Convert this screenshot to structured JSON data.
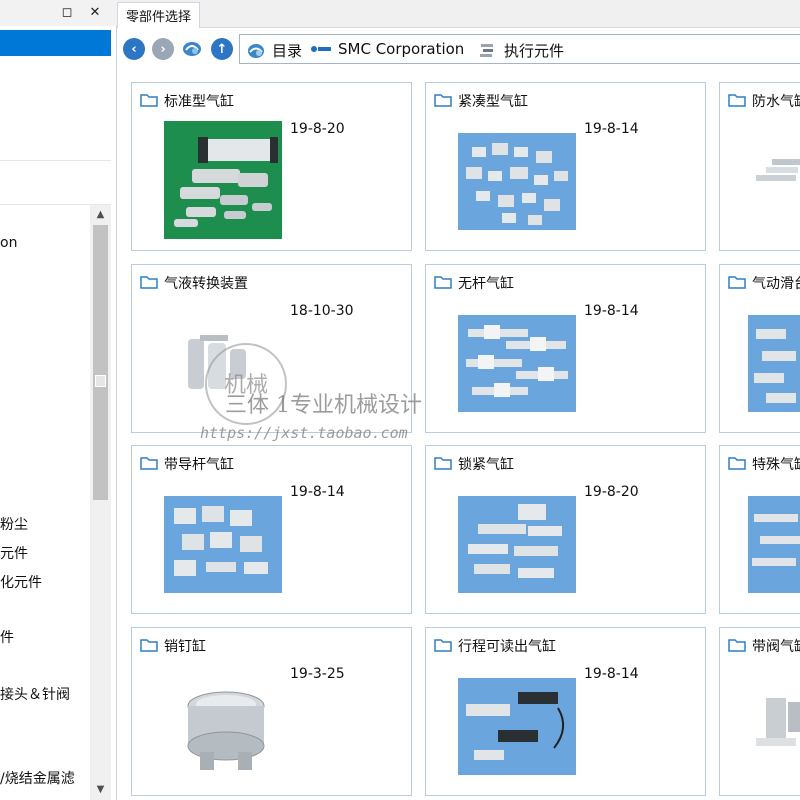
{
  "left_panel": {
    "header_buttons": [
      "◻",
      "✕"
    ],
    "tree_items": [
      "on",
      "粉尘",
      "元件",
      "化元件",
      "件",
      "接头＆针阀",
      "/烧结金属滤"
    ]
  },
  "tab": {
    "label": "零部件选择"
  },
  "breadcrumb": {
    "items": [
      {
        "label": "目录",
        "icon": "catalog-icon"
      },
      {
        "label": "SMC Corporation",
        "icon": "smc-logo-icon"
      },
      {
        "label": "执行元件",
        "icon": "actuator-icon"
      }
    ]
  },
  "colors": {
    "selection": "#0078d7",
    "card_border": "#b9cce0",
    "folder": "#2f7fc1"
  },
  "cards": [
    {
      "title": "标准型气缸",
      "date": "19-8-20"
    },
    {
      "title": "紧凑型气缸",
      "date": "19-8-14"
    },
    {
      "title": "防水气缸",
      "date": ""
    },
    {
      "title": "气液转换装置",
      "date": "18-10-30"
    },
    {
      "title": "无杆气缸",
      "date": "19-8-14"
    },
    {
      "title": "气动滑台",
      "date": ""
    },
    {
      "title": "带导杆气缸",
      "date": "19-8-14"
    },
    {
      "title": "锁紧气缸",
      "date": "19-8-20"
    },
    {
      "title": "特殊气缸",
      "date": ""
    },
    {
      "title": "销钉缸",
      "date": "19-3-25"
    },
    {
      "title": "行程可读出气缸",
      "date": "19-8-14"
    },
    {
      "title": "带阀气缸",
      "date": ""
    }
  ],
  "watermark": {
    "seal_text": "机械",
    "line1": "三体 1专业机械设计",
    "line2": "https://jxst.taobao.com"
  }
}
